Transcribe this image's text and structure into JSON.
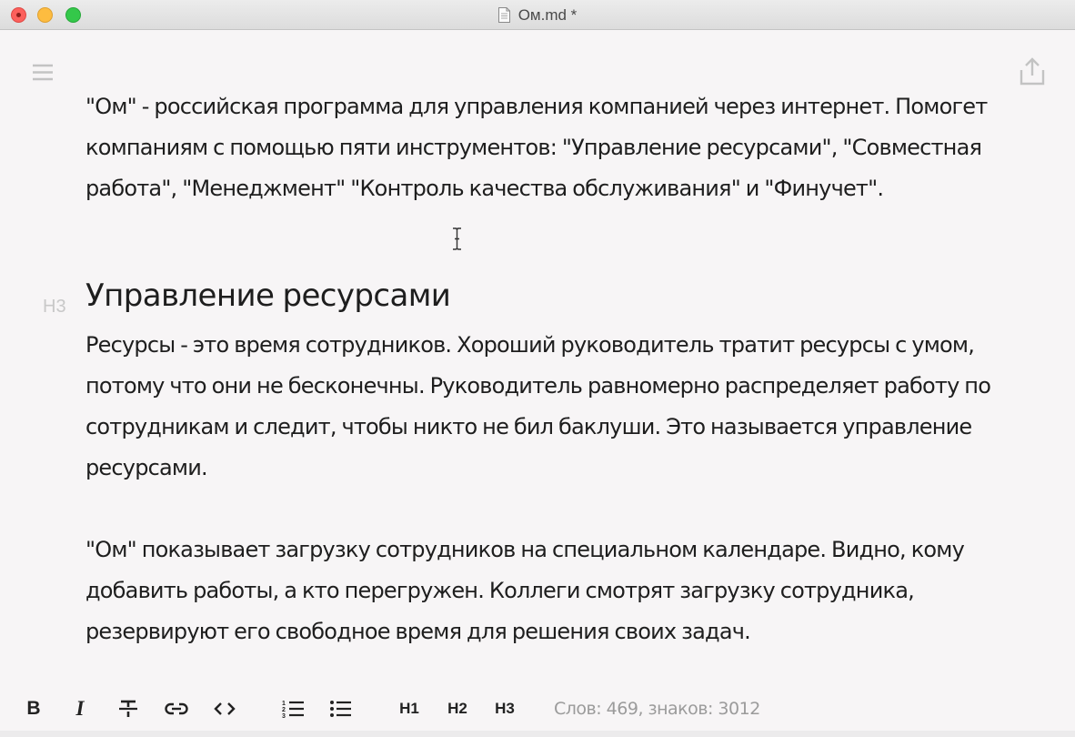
{
  "window": {
    "title": "Ом.md *"
  },
  "document": {
    "paragraph1": "\"Ом\" - российская программа для управления компанией через интернет. Помогет компаниям с помощью пяти инструментов: \"Управление ресурсами\", \"Совместная работа\", \"Менеджмент\" \"Контроль качества обслуживания\" и \"Финучет\".",
    "heading_marker": "H3",
    "heading": "Управление ресурсами",
    "paragraph2": "Ресурсы - это время сотрудников.  Хороший руководитель тратит ресурсы с умом, потому что они не бесконечны. Руководитель равномерно распределяет работу по сотрудникам и следит, чтобы никто не бил баклуши. Это называется управление ресурсами.",
    "paragraph3": "\"Ом\" показывает загрузку сотрудников на специальном календаре. Видно, кому добавить работы, а кто перегружен. Коллеги смотрят загрузку сотрудника, резервируют его свободное время для решения своих задач."
  },
  "toolbar": {
    "bold_label": "B",
    "italic_label": "I",
    "h1_label": "H1",
    "h2_label": "H2",
    "h3_label": "H3",
    "stats": "Слов: 469, знаков: 3012",
    "icons": [
      "bold-icon",
      "italic-icon",
      "strikethrough-icon",
      "link-icon",
      "code-icon",
      "ordered-list-icon",
      "bullet-list-icon"
    ]
  },
  "header_icons": [
    "menu-icon",
    "share-icon"
  ],
  "colors": {
    "background": "#f7f5f6",
    "text": "#1e1e1e",
    "muted": "#9b9b9b",
    "close": "#fc605c",
    "minimize": "#fdbc40",
    "maximize": "#34c84a"
  }
}
